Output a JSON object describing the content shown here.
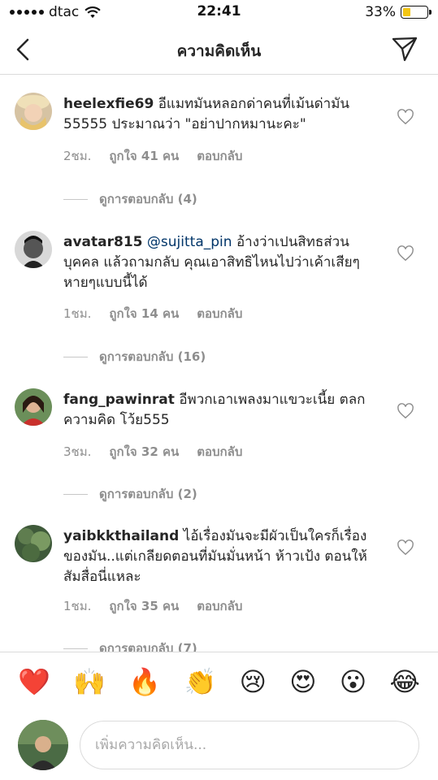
{
  "status_bar": {
    "carrier": "dtac",
    "time": "22:41",
    "battery_percent": "33%",
    "battery_level": 0.33,
    "battery_color": "#f3c614"
  },
  "header": {
    "title": "ความคิดเห็น",
    "back_icon": "chevron-left-icon",
    "send_icon": "paper-plane-icon"
  },
  "comments": [
    {
      "username": "heelexfie69",
      "text": "อีแมทมันหลอกด่าคนที่เม้นด่ามัน 55555 ประมาณว่า \"อย่าปากหมานะคะ\"",
      "time": "2ชม.",
      "likes": "ถูกใจ 41 คน",
      "reply": "ตอบกลับ",
      "view_replies": "ดูการตอบกลับ (4)"
    },
    {
      "username": "avatar815",
      "mention": "@sujitta_pin",
      "text": "อ้างว่าเปนสิทธส่วนบุคคล แล้วถามกลับ คุณเอาสิทธิไหนไปว่าเค้าเสียๆหายๆแบบนี้ได้",
      "time": "1ชม.",
      "likes": "ถูกใจ 14 คน",
      "reply": "ตอบกลับ",
      "view_replies": "ดูการตอบกลับ (16)"
    },
    {
      "username": "fang_pawinrat",
      "text": "อีพวกเอาเพลงมาแขวะเนี้ย ตลกความคิด โว้ย555",
      "time": "3ชม.",
      "likes": "ถูกใจ 32 คน",
      "reply": "ตอบกลับ",
      "view_replies": "ดูการตอบกลับ (2)"
    },
    {
      "username": "yaibkkthailand",
      "text": "ไอ้เรื่องมันจะมีผัวเป็นใครก็เรื่องของมัน..แต่เกลียดตอนที่มันมั่นหน้า ห้าวเป้ง ตอนให้สัมสื่อนี่แหละ",
      "time": "1ชม.",
      "likes": "ถูกใจ 35 คน",
      "reply": "ตอบกลับ",
      "view_replies": "ดูการตอบกลับ (7)"
    }
  ],
  "emoji_bar": [
    "❤️",
    "🙌",
    "🔥",
    "👏",
    "😢",
    "😍",
    "😮",
    "😂"
  ],
  "input": {
    "placeholder": "เพิ่มความคิดเห็น..."
  }
}
